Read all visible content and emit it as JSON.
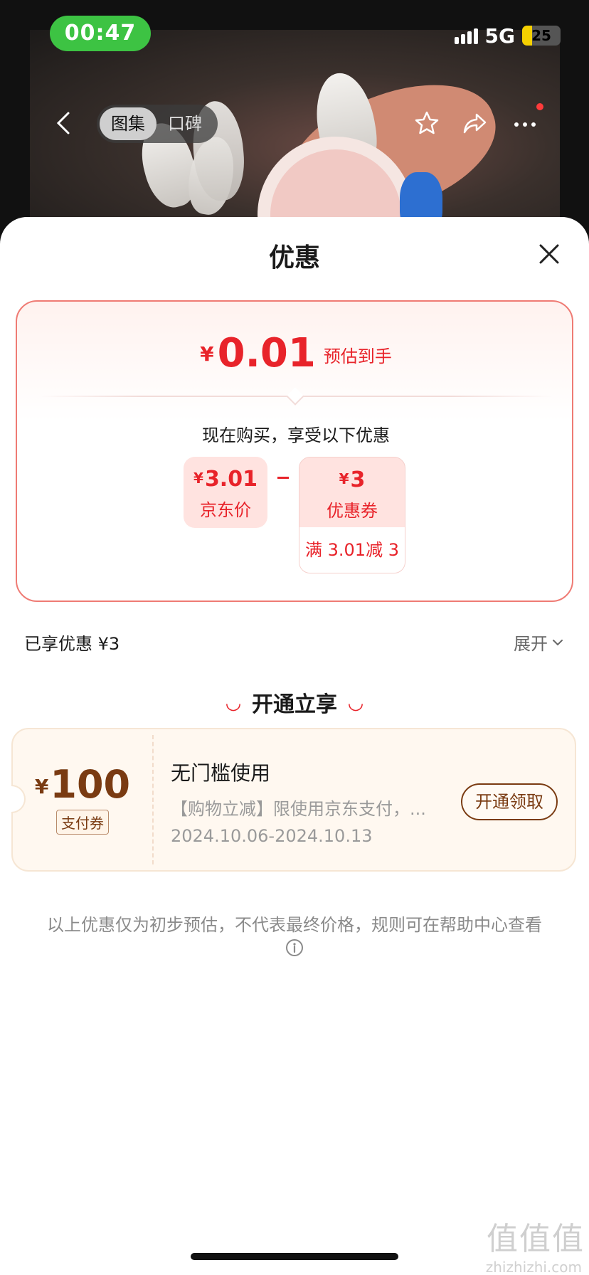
{
  "status_bar": {
    "time": "00:47",
    "network": "5G",
    "battery": "25",
    "battery_level_percent": 25
  },
  "nav": {
    "tabs": [
      {
        "label": "图集",
        "active": true
      },
      {
        "label": "口碑",
        "active": false
      }
    ],
    "icons": [
      "back-icon",
      "star-icon",
      "share-icon",
      "more-icon"
    ]
  },
  "sheet": {
    "title": "优惠",
    "estimate": {
      "currency": "¥",
      "amount": "0.01",
      "label": "预估到手"
    },
    "subtitle": "现在购买，享受以下优惠",
    "price_chip": {
      "currency": "¥",
      "amount": "3.01",
      "label": "京东价"
    },
    "discount_chip": {
      "currency": "¥",
      "amount": "3",
      "label": "优惠券",
      "condition": "满 3.01减 3"
    },
    "enjoyed": "已享优惠 ¥3",
    "expand": "展开",
    "section_title": "开通立享",
    "coupon": {
      "currency": "¥",
      "amount": "100",
      "tag": "支付券",
      "title": "无门槛使用",
      "desc": "【购物立减】限使用京东支付，...",
      "date": "2024.10.06-2024.10.13",
      "button": "开通领取"
    },
    "disclaimer": "以上优惠仅为初步预估，不代表最终价格，规则可在帮助中心查看"
  },
  "watermark": {
    "main": "值值值",
    "sub": "zhizhizhi.com"
  },
  "colors": {
    "accent_red": "#e8232a",
    "status_green": "#3dc343",
    "coupon_brown": "#7a3b12"
  }
}
